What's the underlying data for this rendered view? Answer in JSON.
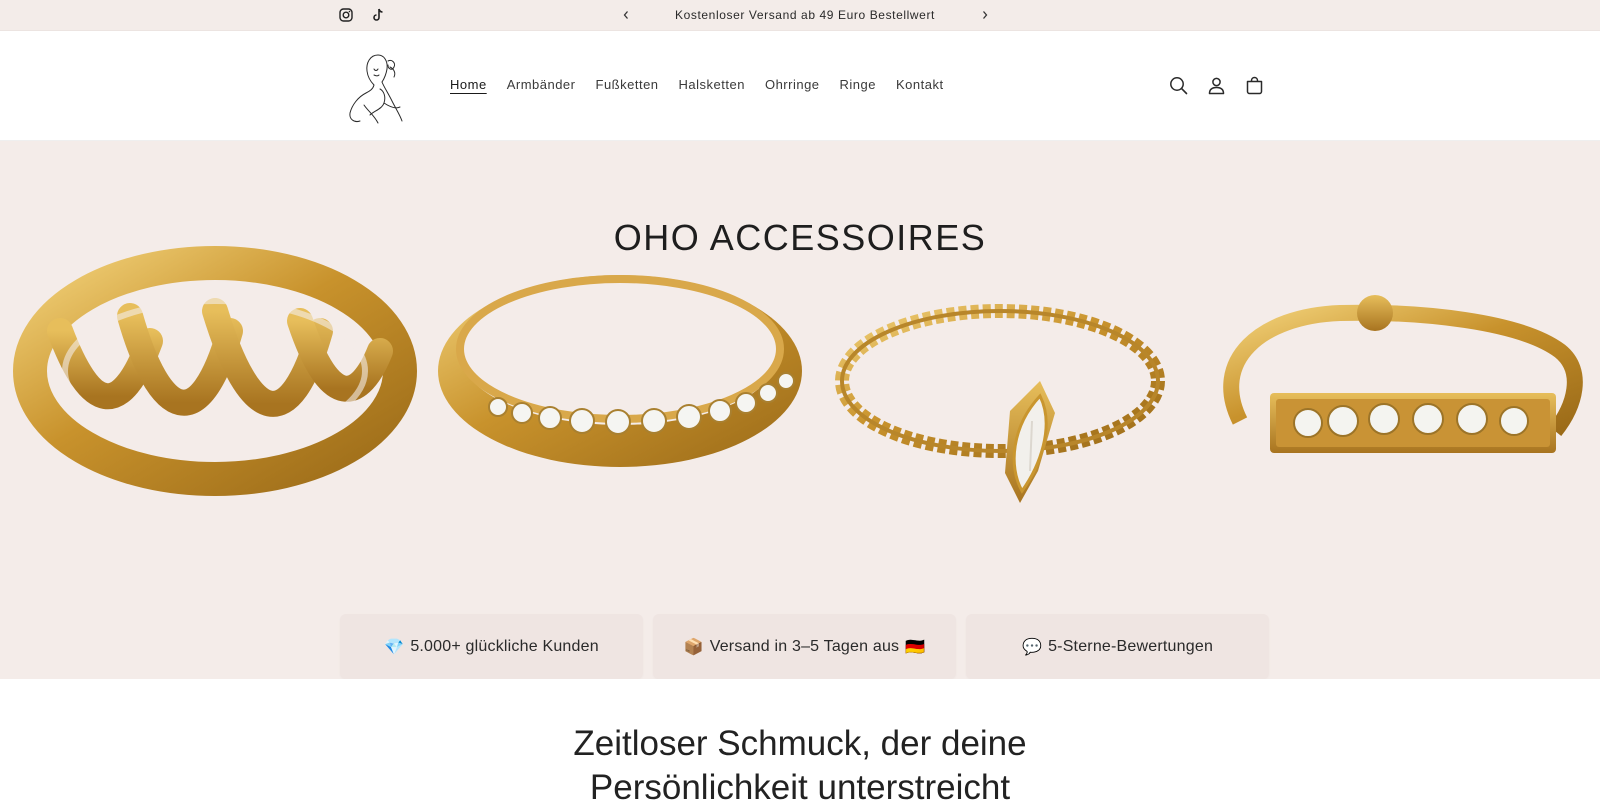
{
  "announcement": {
    "text": "Kostenloser Versand ab 49 Euro Bestellwert"
  },
  "social": [
    "instagram-icon",
    "tiktok-icon"
  ],
  "nav": {
    "items": [
      {
        "label": "Home"
      },
      {
        "label": "Armbänder"
      },
      {
        "label": "Fußketten"
      },
      {
        "label": "Halsketten"
      },
      {
        "label": "Ohrringe"
      },
      {
        "label": "Ringe"
      },
      {
        "label": "Kontakt"
      }
    ]
  },
  "header_icons": [
    "search-icon",
    "account-icon",
    "cart-icon"
  ],
  "hero": {
    "title": "OHO ACCESSOIRES",
    "badges": [
      {
        "emoji": "💎",
        "text": "5.000+ glückliche Kunden"
      },
      {
        "emoji": "📦",
        "text": "Versand in 3–5 Tagen aus",
        "suffix": "🇩🇪"
      },
      {
        "emoji": "💬",
        "text": "5-Sterne-Bewertungen"
      }
    ]
  },
  "section": {
    "heading_line1": "Zeitloser Schmuck, der deine",
    "heading_line2": "Persönlichkeit unterstreicht"
  },
  "colors": {
    "hero_bg": "#f4ece9",
    "announce_bg": "#f3ece9",
    "gold": "#c9962f",
    "badge_bg": "#efe5e2"
  }
}
